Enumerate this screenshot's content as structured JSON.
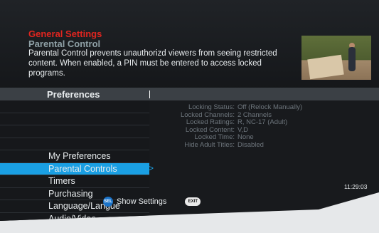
{
  "header": {
    "title": "General Settings",
    "subtitle": "Parental Control",
    "description": "Parental Control prevents unauthorizd viewers from seeing restricted content. When enabled, a PIN must be entered to access locked programs."
  },
  "preferences_label": "Preferences",
  "menu": {
    "items": [
      {
        "label": ""
      },
      {
        "label": ""
      },
      {
        "label": ""
      },
      {
        "label": ""
      },
      {
        "label": "My Preferences"
      },
      {
        "label": "Parental Controls"
      },
      {
        "label": "Timers"
      },
      {
        "label": "Purchasing"
      },
      {
        "label": "Language/Langue"
      },
      {
        "label": "Audio/Video"
      }
    ],
    "selected_index": 5,
    "selected_indicator": "<>"
  },
  "details": [
    {
      "key": "Locking Status:",
      "value": "Off (Relock Manually)"
    },
    {
      "key": "Locked Channels:",
      "value": "2 Channels"
    },
    {
      "key": "Locked Ratings:",
      "value": "R, NC-17 (Adult)"
    },
    {
      "key": "Locked Content:",
      "value": "V,D"
    },
    {
      "key": "Locked Time:",
      "value": "None"
    },
    {
      "key": "Hide Adult Titles:",
      "value": "Disabled"
    }
  ],
  "clock": "11:29:03",
  "footer": {
    "sel_label": "SEL",
    "show_settings": "Show Settings",
    "exit_label": "EXIT"
  },
  "colors": {
    "accent_blue": "#1a9fe3",
    "title_red": "#e0251f",
    "subtitle": "#8fa0a6",
    "background": "#181a1d"
  },
  "icons": {
    "selection": "chevron-left-right-icon",
    "program": "video-thumbnail"
  }
}
